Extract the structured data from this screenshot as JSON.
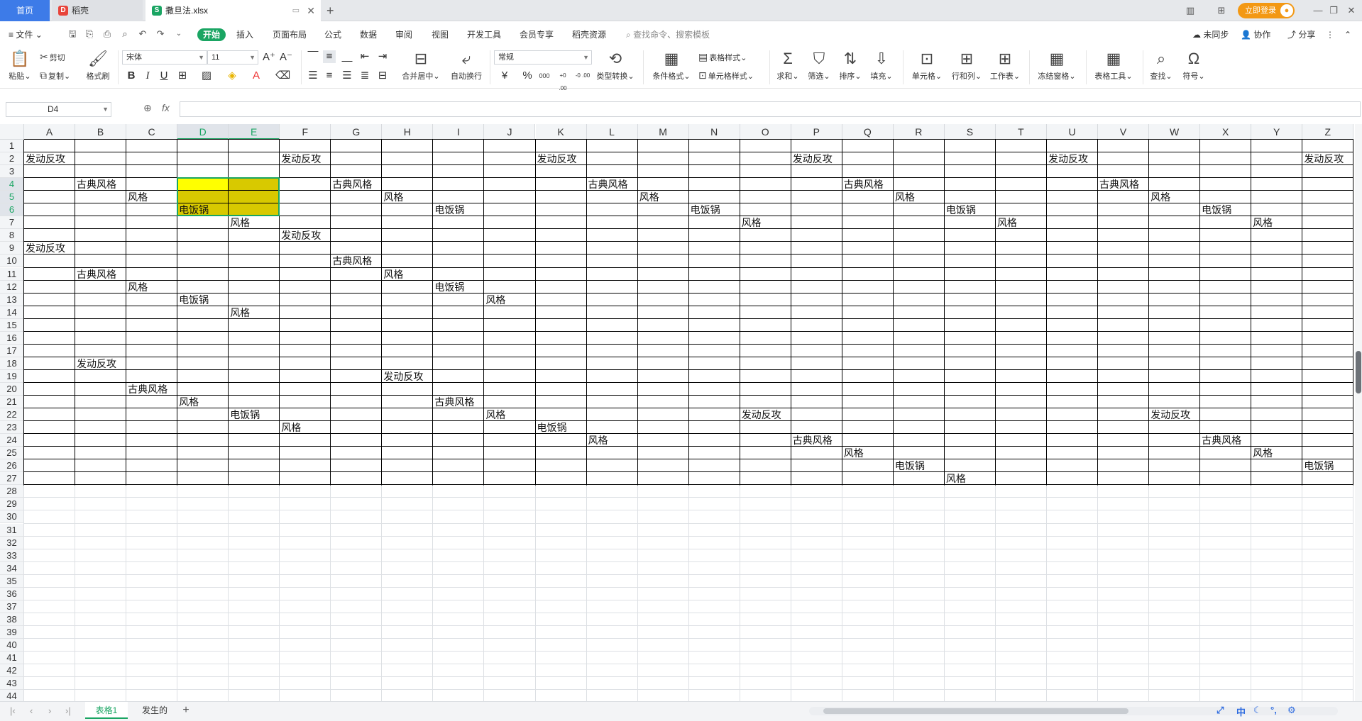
{
  "tabs": {
    "home": "首页",
    "daoke": "稻壳",
    "file": "撒旦法.xlsx",
    "login": "立即登录"
  },
  "menu": {
    "file": "文件",
    "items": [
      "开始",
      "插入",
      "页面布局",
      "公式",
      "数据",
      "审阅",
      "视图",
      "开发工具",
      "会员专享",
      "稻壳资源"
    ],
    "search": "查找命令、搜索模板",
    "sync": "未同步",
    "collab": "协作",
    "share": "分享"
  },
  "ribbon": {
    "paste": "粘贴",
    "cut": "剪切",
    "copy": "复制",
    "format_painter": "格式刷",
    "font": "宋体",
    "size": "11",
    "number_format": "常规",
    "merge": "合并居中",
    "wrap": "自动换行",
    "convert": "类型转换",
    "cond_format": "条件格式",
    "table_style": "表格样式",
    "cell_style": "单元格样式",
    "sum": "求和",
    "filter": "筛选",
    "sort": "排序",
    "fill": "填充",
    "cell": "单元格",
    "rowcol": "行和列",
    "sheet": "工作表",
    "freeze": "冻结窗格",
    "table_tools": "表格工具",
    "find": "查找",
    "symbol": "符号",
    "currency_glyph": "¥",
    "percent_glyph": "%",
    "thousands_glyph": "000",
    "dec_inc_glyph": "+0 .00",
    "dec_dec_glyph": "-0 .00"
  },
  "formula_bar": {
    "name_box": "D4",
    "fx": "fx",
    "content": ""
  },
  "grid": {
    "columns": [
      "A",
      "B",
      "C",
      "D",
      "E",
      "F",
      "G",
      "H",
      "I",
      "J",
      "K",
      "L",
      "M",
      "N",
      "O",
      "P",
      "Q",
      "R",
      "S",
      "T",
      "U",
      "V",
      "W",
      "X",
      "Y",
      "Z"
    ],
    "rows": [
      "1",
      "2",
      "3",
      "4",
      "5",
      "6",
      "7",
      "8",
      "9",
      "10",
      "11",
      "12",
      "13",
      "14",
      "15",
      "16",
      "17",
      "18",
      "19",
      "20",
      "21",
      "22",
      "23",
      "24",
      "25",
      "26",
      "27",
      "28",
      "29",
      "30",
      "31",
      "32",
      "33",
      "34",
      "35",
      "36",
      "37",
      "38",
      "39",
      "40",
      "41",
      "42",
      "43",
      "44"
    ],
    "active_col": [
      "D",
      "E"
    ],
    "active_rows": [
      4,
      5,
      6
    ],
    "cells": [
      {
        "r": 2,
        "c": "A",
        "v": "发动反攻"
      },
      {
        "r": 2,
        "c": "F",
        "v": "发动反攻"
      },
      {
        "r": 2,
        "c": "K",
        "v": "发动反攻"
      },
      {
        "r": 2,
        "c": "P",
        "v": "发动反攻"
      },
      {
        "r": 2,
        "c": "U",
        "v": "发动反攻"
      },
      {
        "r": 2,
        "c": "Z",
        "v": "发动反攻"
      },
      {
        "r": 4,
        "c": "B",
        "v": "古典风格"
      },
      {
        "r": 4,
        "c": "G",
        "v": "古典风格"
      },
      {
        "r": 4,
        "c": "L",
        "v": "古典风格"
      },
      {
        "r": 4,
        "c": "Q",
        "v": "古典风格"
      },
      {
        "r": 4,
        "c": "V",
        "v": "古典风格"
      },
      {
        "r": 5,
        "c": "C",
        "v": "风格"
      },
      {
        "r": 5,
        "c": "H",
        "v": "风格"
      },
      {
        "r": 5,
        "c": "M",
        "v": "风格"
      },
      {
        "r": 5,
        "c": "R",
        "v": "风格"
      },
      {
        "r": 5,
        "c": "W",
        "v": "风格"
      },
      {
        "r": 6,
        "c": "D",
        "v": "电饭锅"
      },
      {
        "r": 6,
        "c": "I",
        "v": "电饭锅"
      },
      {
        "r": 6,
        "c": "N",
        "v": "电饭锅"
      },
      {
        "r": 6,
        "c": "S",
        "v": "电饭锅"
      },
      {
        "r": 6,
        "c": "X",
        "v": "电饭锅"
      },
      {
        "r": 7,
        "c": "E",
        "v": "风格"
      },
      {
        "r": 7,
        "c": "O",
        "v": "风格"
      },
      {
        "r": 7,
        "c": "T",
        "v": "风格"
      },
      {
        "r": 7,
        "c": "Y",
        "v": "风格"
      },
      {
        "r": 8,
        "c": "F",
        "v": "发动反攻"
      },
      {
        "r": 9,
        "c": "A",
        "v": "发动反攻"
      },
      {
        "r": 10,
        "c": "G",
        "v": "古典风格"
      },
      {
        "r": 11,
        "c": "B",
        "v": "古典风格"
      },
      {
        "r": 11,
        "c": "H",
        "v": "风格"
      },
      {
        "r": 12,
        "c": "C",
        "v": "风格"
      },
      {
        "r": 12,
        "c": "I",
        "v": "电饭锅"
      },
      {
        "r": 13,
        "c": "D",
        "v": "电饭锅"
      },
      {
        "r": 13,
        "c": "J",
        "v": "风格"
      },
      {
        "r": 14,
        "c": "E",
        "v": "风格"
      },
      {
        "r": 18,
        "c": "B",
        "v": "发动反攻"
      },
      {
        "r": 19,
        "c": "H",
        "v": "发动反攻"
      },
      {
        "r": 20,
        "c": "C",
        "v": "古典风格"
      },
      {
        "r": 21,
        "c": "D",
        "v": "风格"
      },
      {
        "r": 21,
        "c": "I",
        "v": "古典风格"
      },
      {
        "r": 22,
        "c": "E",
        "v": "电饭锅"
      },
      {
        "r": 22,
        "c": "J",
        "v": "风格"
      },
      {
        "r": 22,
        "c": "O",
        "v": "发动反攻"
      },
      {
        "r": 22,
        "c": "W",
        "v": "发动反攻"
      },
      {
        "r": 23,
        "c": "F",
        "v": "风格"
      },
      {
        "r": 23,
        "c": "K",
        "v": "电饭锅"
      },
      {
        "r": 24,
        "c": "L",
        "v": "风格"
      },
      {
        "r": 24,
        "c": "P",
        "v": "古典风格"
      },
      {
        "r": 24,
        "c": "X",
        "v": "古典风格"
      },
      {
        "r": 25,
        "c": "Q",
        "v": "风格"
      },
      {
        "r": 25,
        "c": "Y",
        "v": "风格"
      },
      {
        "r": 26,
        "c": "R",
        "v": "电饭锅"
      },
      {
        "r": 26,
        "c": "Z",
        "v": "电饭锅"
      },
      {
        "r": 27,
        "c": "S",
        "v": "风格"
      }
    ],
    "fills": [
      {
        "r": 4,
        "c": "D",
        "color": "#ffff00"
      },
      {
        "r": 4,
        "c": "E",
        "color": "#d8c900"
      },
      {
        "r": 5,
        "c": "D",
        "color": "#d8c900"
      },
      {
        "r": 5,
        "c": "E",
        "color": "#d8c900"
      },
      {
        "r": 6,
        "c": "D",
        "color": "#d8c900"
      },
      {
        "r": 6,
        "c": "E",
        "color": "#d8c900"
      }
    ],
    "bordered_rows": 27
  },
  "sheets": {
    "tabs": [
      "表格1",
      "发生的"
    ],
    "active": "表格1",
    "add": "+"
  },
  "tray": {
    "ime": "中"
  },
  "colors": {
    "accent": "#1aa563",
    "home_tab": "#3d7be8",
    "login": "#f39813"
  }
}
